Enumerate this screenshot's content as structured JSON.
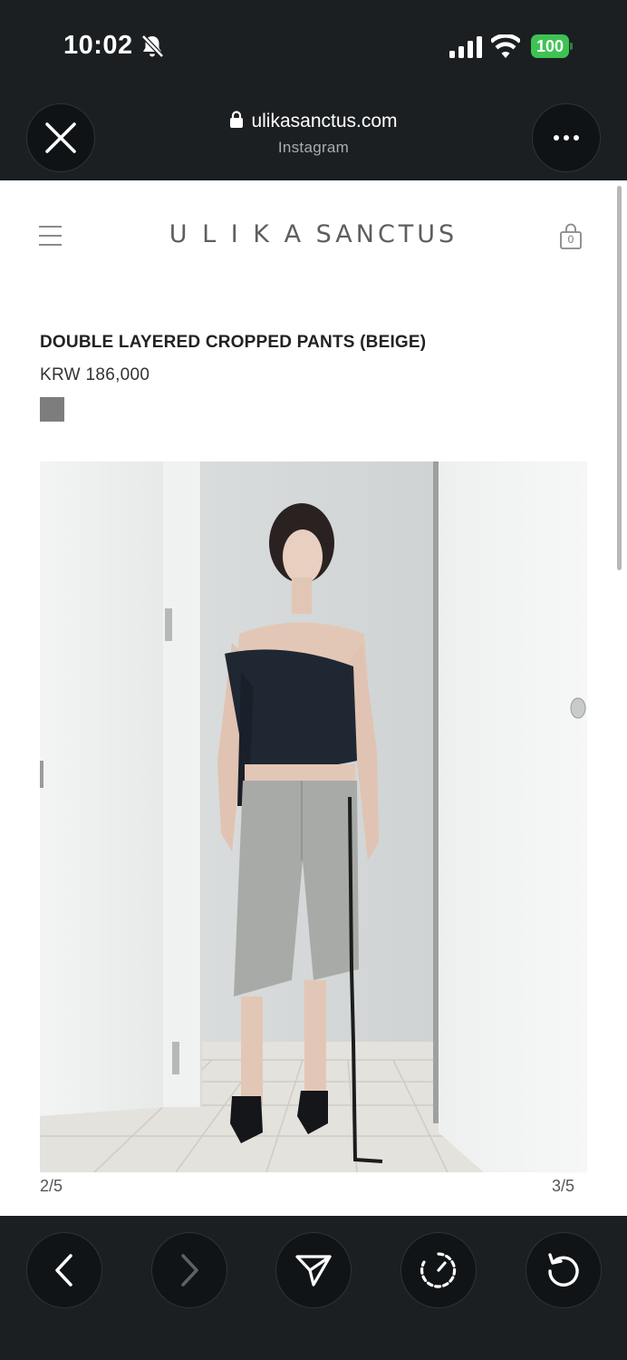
{
  "status_bar": {
    "time": "10:02",
    "battery": "100"
  },
  "browser": {
    "url": "ulikasanctus.com",
    "source": "Instagram"
  },
  "site": {
    "brand": "U L I K A SANCTUS",
    "cart_count": "0"
  },
  "product": {
    "title": "DOUBLE LAYERED CROPPED PANTS (BEIGE)",
    "price": "KRW 186,000",
    "swatch_color": "#7d7d7d"
  },
  "gallery": {
    "left_counter": "2/5",
    "right_counter": "3/5"
  },
  "colors": {
    "chrome": "#1b1f22",
    "battery_green": "#3ec253"
  }
}
